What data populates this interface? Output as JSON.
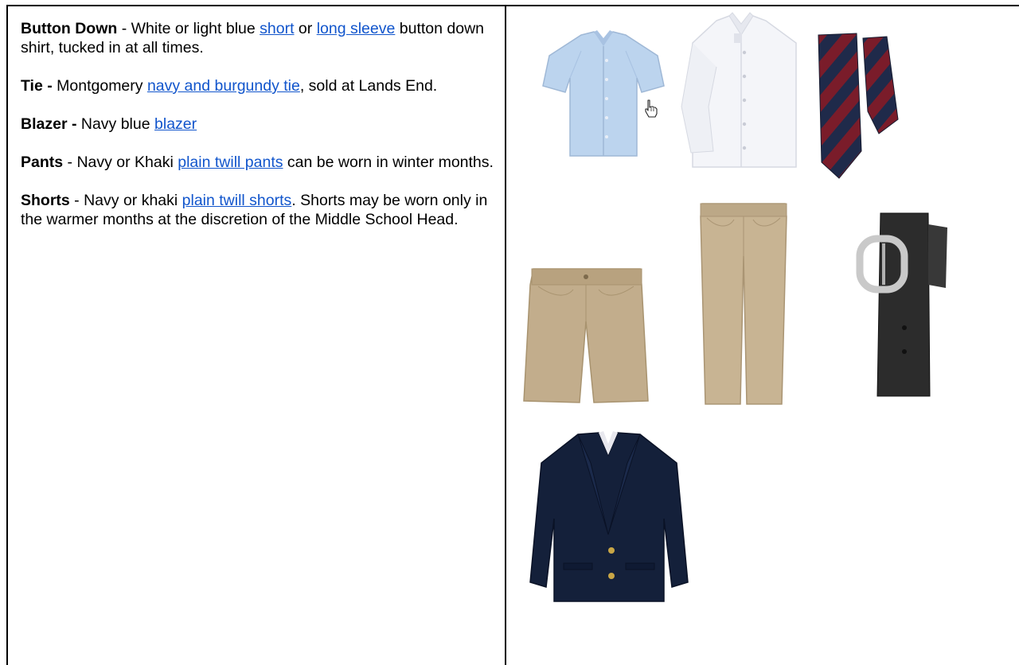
{
  "items": [
    {
      "title": "Button Down",
      "title_sep": " - ",
      "before1": " White or light blue ",
      "link1": "short",
      "mid": " or ",
      "link2": "long sleeve",
      "after": " button down shirt, tucked in at all times."
    },
    {
      "title": "Tie -",
      "before1": " Montgomery ",
      "link1": "navy and burgundy tie",
      "after": ", sold at Lands End."
    },
    {
      "title": "Blazer -",
      "before1": " Navy blue ",
      "link1": "blazer"
    },
    {
      "title": "Pants",
      "before1": " - Navy or Khaki ",
      "link1": "plain twill pants",
      "after": " can be worn in winter months."
    },
    {
      "title": "Shorts",
      "before1": " - Navy or khaki ",
      "link1": "plain twill shorts",
      "after": ". Shorts may be worn only in the warmer months at the discretion of the Middle School Head."
    }
  ],
  "colors": {
    "link": "#1155cc",
    "light_blue_shirt": "#bcd4ee",
    "white_shirt": "#f4f5f9",
    "tie_navy": "#1f2a4a",
    "tie_burgundy": "#7a1c2a",
    "khaki": "#c2ad8c",
    "belt": "#2c2c2c",
    "blazer": "#14203a"
  },
  "icons": [
    "short-sleeve-shirt-image",
    "long-sleeve-shirt-image",
    "striped-tie-image",
    "khaki-shorts-image",
    "khaki-pants-image",
    "black-belt-image",
    "navy-blazer-image",
    "hand-pointer-icon"
  ]
}
